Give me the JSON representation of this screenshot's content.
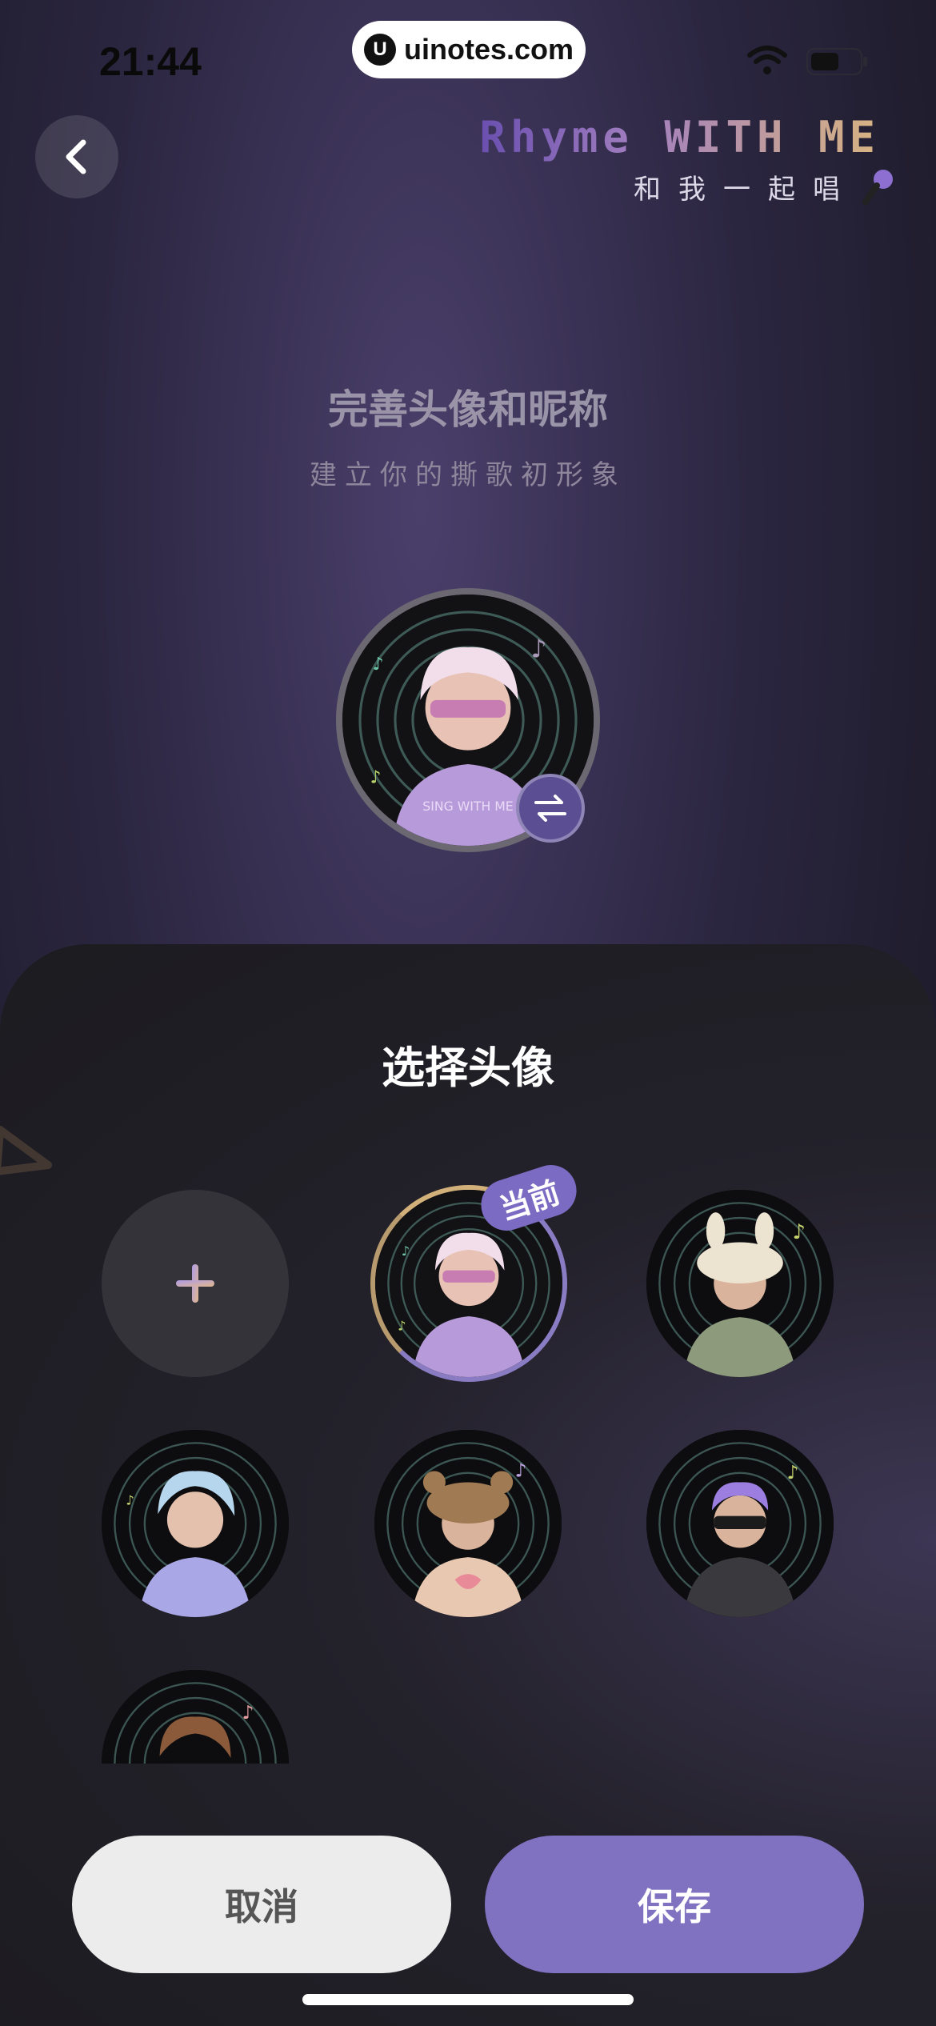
{
  "status_bar": {
    "time": "21:44",
    "url": "uinotes.com",
    "url_logo": "U"
  },
  "header": {
    "brand_title": "Rhyme WITH ME",
    "brand_subtitle": "和我一起唱"
  },
  "intro": {
    "title": "完善头像和昵称",
    "subtitle": "建立你的撕歌初形象",
    "avatar_caption": "SING WITH ME"
  },
  "sheet": {
    "title": "选择头像",
    "current_badge": "当前",
    "avatars": [
      {
        "name": "add",
        "icon": "plus-icon"
      },
      {
        "name": "pink-hair-sunglasses",
        "current": true
      },
      {
        "name": "bunny-hat"
      },
      {
        "name": "blue-hair"
      },
      {
        "name": "bear-hat"
      },
      {
        "name": "purple-hair"
      },
      {
        "name": "brown-hair"
      }
    ]
  },
  "actions": {
    "cancel_label": "取消",
    "save_label": "保存"
  },
  "colors": {
    "accent": "#8072c1",
    "badge": "#7b6bc2",
    "sheet_bg": "#1c1b20"
  }
}
